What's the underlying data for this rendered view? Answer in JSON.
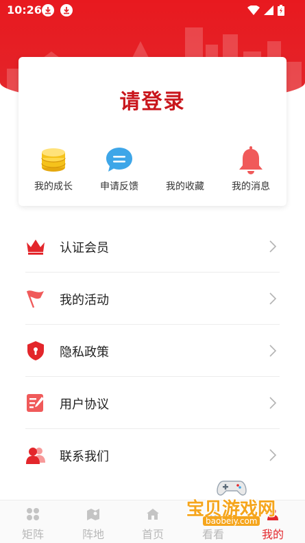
{
  "status_bar": {
    "time": "10:26"
  },
  "login_card": {
    "title": "请登录",
    "quick_links": [
      {
        "label": "我的成长",
        "icon": "coins-icon"
      },
      {
        "label": "申请反馈",
        "icon": "chat-bubble-icon"
      },
      {
        "label": "我的收藏",
        "icon": "favorites-icon"
      },
      {
        "label": "我的消息",
        "icon": "bell-icon"
      }
    ]
  },
  "menu": [
    {
      "label": "认证会员",
      "icon": "crown-icon"
    },
    {
      "label": "我的活动",
      "icon": "flag-icon"
    },
    {
      "label": "隐私政策",
      "icon": "shield-icon"
    },
    {
      "label": "用户协议",
      "icon": "document-edit-icon"
    },
    {
      "label": "联系我们",
      "icon": "contacts-icon"
    }
  ],
  "bottom_nav": [
    {
      "label": "矩阵",
      "icon": "grid-icon"
    },
    {
      "label": "阵地",
      "icon": "map-icon"
    },
    {
      "label": "首页",
      "icon": "home-icon"
    },
    {
      "label": "看看",
      "icon": "eye-icon"
    },
    {
      "label": "我的",
      "icon": "profile-icon",
      "active": true
    }
  ],
  "watermark": {
    "text": "宝贝游戏网",
    "url": "baobeiy.com"
  },
  "colors": {
    "brand_red": "#e3262b",
    "title_red": "#c9161c",
    "coin_yellow": "#f5c21b",
    "chat_blue": "#3ea6e8",
    "icon_red": "#f05a5a"
  }
}
